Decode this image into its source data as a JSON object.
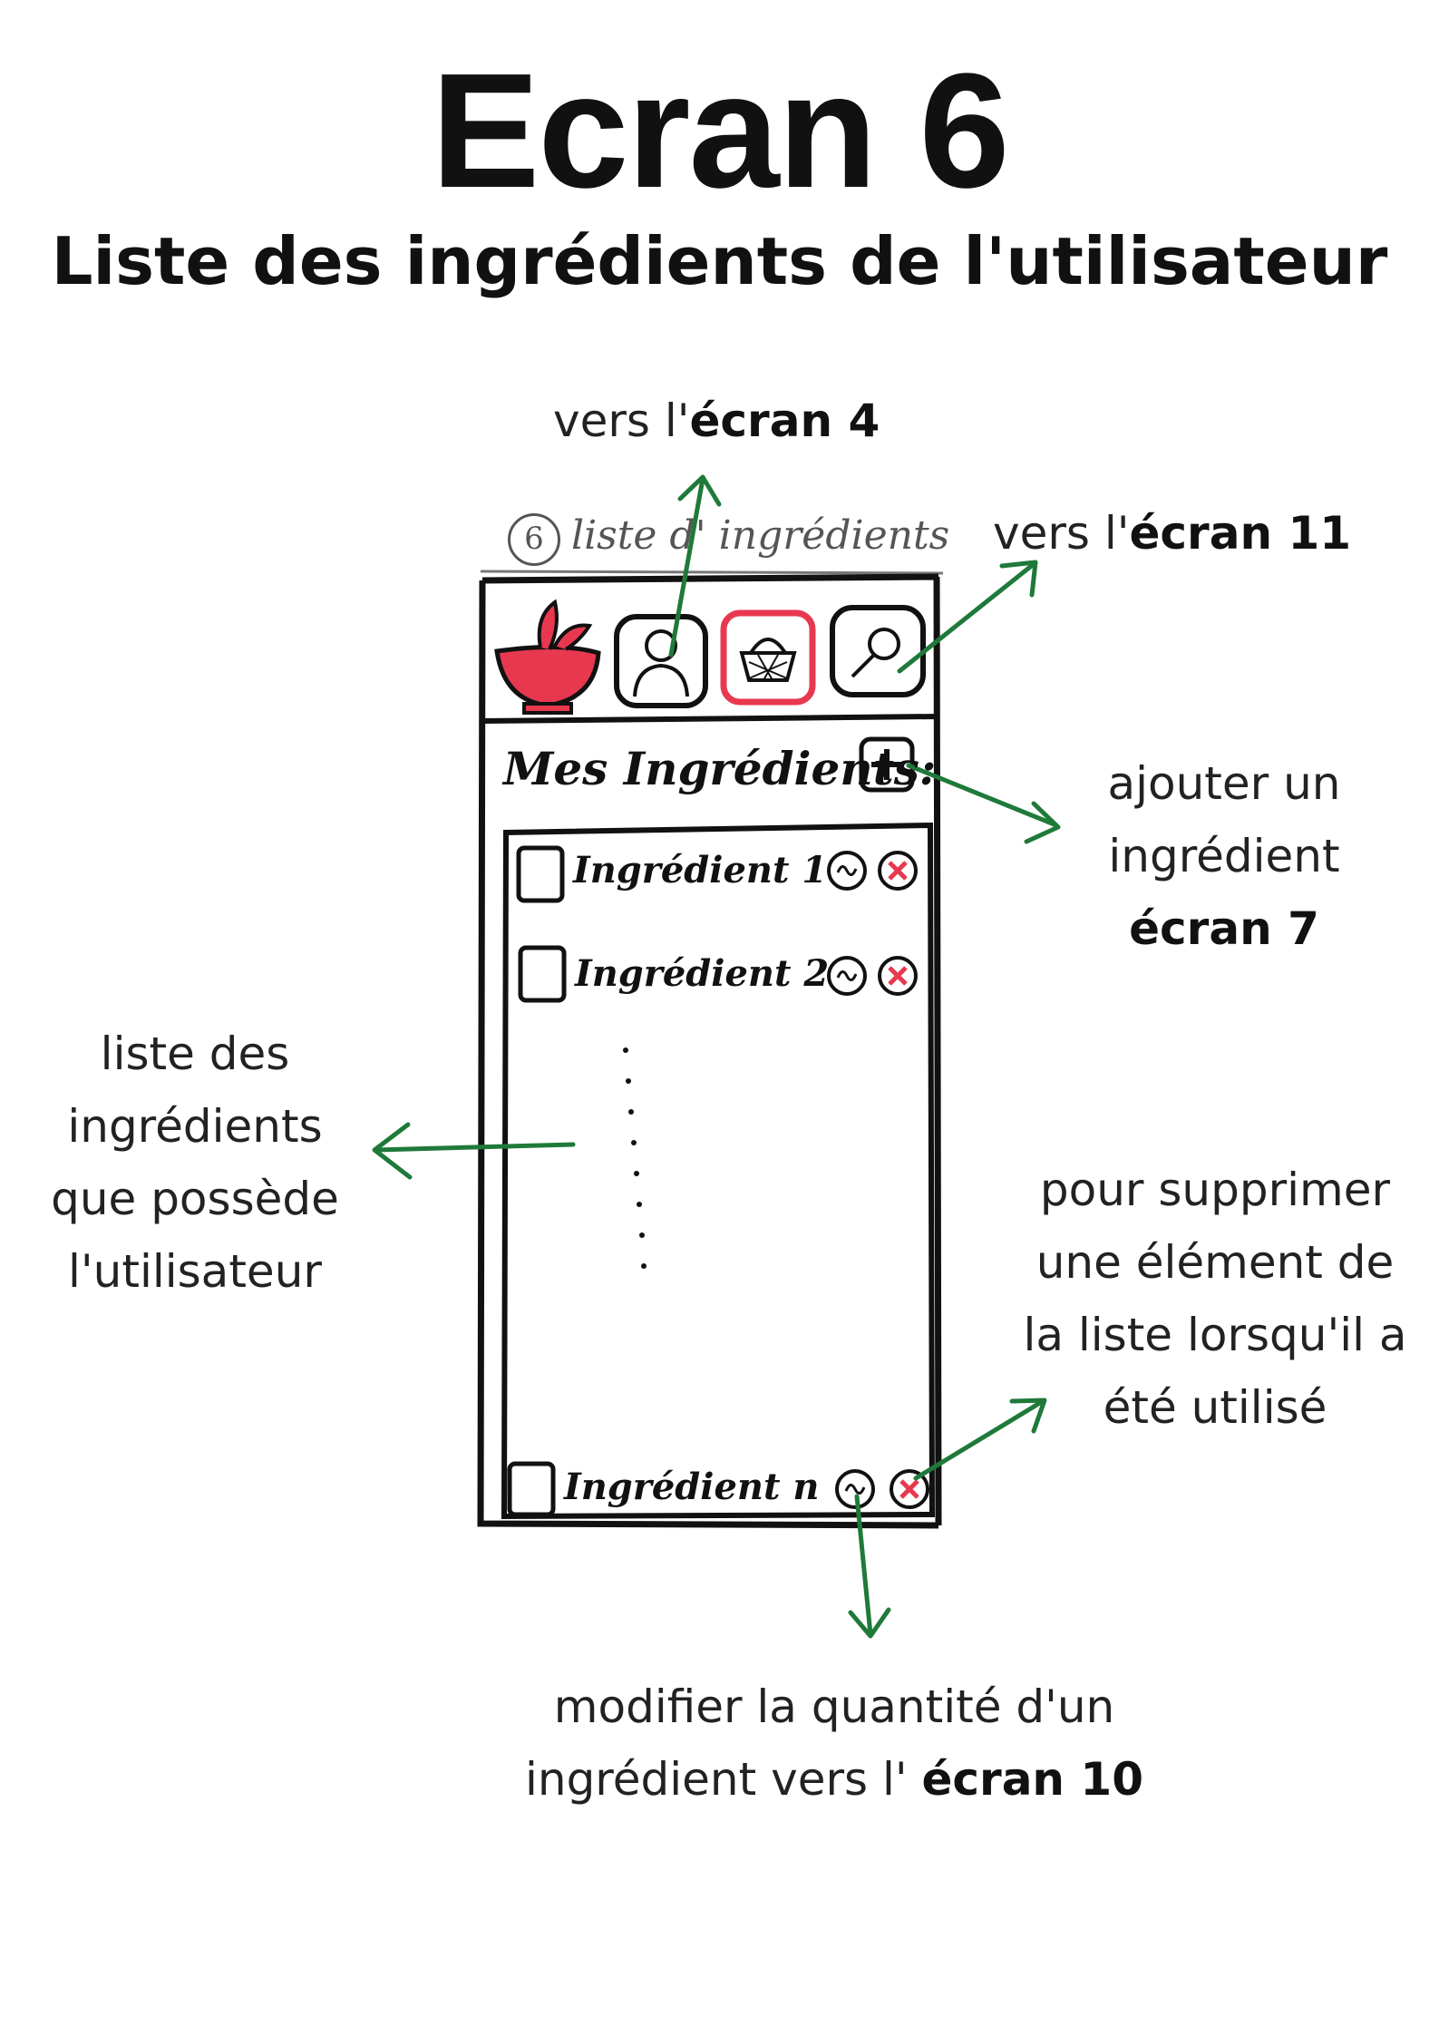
{
  "header": {
    "title": "Ecran 6",
    "subtitle": "Liste des ingrédients de l'utilisateur"
  },
  "sketch": {
    "screen_number": "6",
    "caption": "liste d' ingrédients",
    "section_title": "Mes Ingrédients:",
    "items": [
      {
        "label": "Ingrédient 1"
      },
      {
        "label": "Ingrédient 2"
      },
      {
        "label": "Ingrédient n"
      }
    ],
    "colors": {
      "accent_red": "#e8384f",
      "arrow_green": "#1f7a3a",
      "ink": "#111111"
    }
  },
  "annotations": {
    "to_screen_4": {
      "prefix": "vers l'",
      "bold": "écran 4"
    },
    "to_screen_11": {
      "prefix": "vers l'",
      "bold": "écran 11"
    },
    "add_ingredient": {
      "line1": "ajouter un",
      "line2": "ingrédient",
      "bold": "écran 7"
    },
    "ingredient_list": {
      "line1": "liste des",
      "line2": "ingrédients",
      "line3": "que possède",
      "line4": "l'utilisateur"
    },
    "delete_item": {
      "line1": "pour supprimer",
      "line2": "une élément de",
      "line3": "la liste lorsqu'il a",
      "line4": "été utilisé"
    },
    "modify_quantity": {
      "line1": "modifier la quantité d'un",
      "line2_prefix": "ingrédient vers l' ",
      "bold": "écran 10"
    }
  }
}
